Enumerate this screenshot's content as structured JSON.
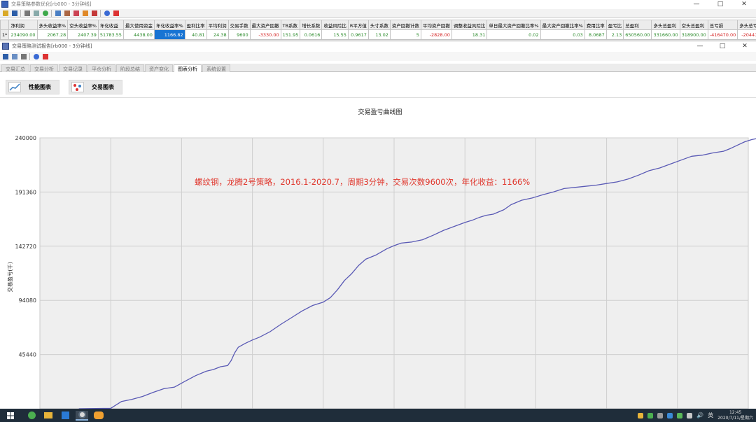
{
  "outer_window": {
    "title": "交易策略参数优化[rb000 - 3分钟线]",
    "controls": {
      "minimize": "—",
      "maximize": "□",
      "close": "✕"
    }
  },
  "metrics_table": {
    "headers": [
      "净利润",
      "多头收益率%",
      "空头收益率%",
      "年化收益",
      "最大使用资金",
      "年化收益率%",
      "盈利比率",
      "平均利润",
      "交易手数",
      "最大资产回撤",
      "TB系数",
      "增长系数",
      "收益风险比",
      "R平方值",
      "头寸系数",
      "资产回撤计数",
      "平均资产回撤",
      "调整收益风险比",
      "单日最大资产回撤比率%",
      "最大资产回撤比率%",
      "费用比率",
      "盈亏比",
      "总盈利",
      "多头总盈利",
      "空头总盈利",
      "总亏损",
      "多头总亏"
    ],
    "row_label": "1*",
    "values": [
      "234090.00",
      "2067.28",
      "2407.39",
      "51783.55",
      "4438.00",
      "1166.82",
      "40.81",
      "24.38",
      "9600",
      "-3330.00",
      "151.95",
      "0.0616",
      "15.55",
      "0.9617",
      "13.02",
      "5",
      "-2828.00",
      "18.31",
      "0.02",
      "0.03",
      "8.0687",
      "2.13",
      "650560.00",
      "331660.00",
      "318900.00",
      "-416470.00",
      "-20441"
    ]
  },
  "inner_window": {
    "title": "交易策略测试报告[rb000 - 3分钟线]",
    "controls": {
      "minimize": "—",
      "maximize": "□",
      "close": "✕"
    }
  },
  "tabs": [
    "交易汇总",
    "交易分析",
    "交易记录",
    "平仓分析",
    "阶段总结",
    "资产变化",
    "图表分析",
    "系统设置"
  ],
  "active_tab": "图表分析",
  "chart_buttons": {
    "performance": "性能图表",
    "trade": "交易图表"
  },
  "chart_data": {
    "type": "line",
    "title": "交易盈亏曲线图",
    "ylabel": "交易盈亏(千)",
    "xlabel": "",
    "yticks": [
      45440,
      94080,
      142720,
      191360,
      240000
    ],
    "ylim": [
      -3200,
      240000
    ],
    "grid": true,
    "annotation": "螺纹钢，龙腾2号策略，2016.1-2020.7，周期3分钟，交易次数9600次，年化收益：1166%",
    "series": [
      {
        "color": "#5a5ab5",
        "points": [
          [
            0.055,
            -3200
          ],
          [
            0.1,
            -2800
          ],
          [
            0.115,
            3200
          ],
          [
            0.13,
            5200
          ],
          [
            0.145,
            7800
          ],
          [
            0.16,
            11500
          ],
          [
            0.175,
            14800
          ],
          [
            0.19,
            16200
          ],
          [
            0.205,
            21500
          ],
          [
            0.22,
            26500
          ],
          [
            0.235,
            30500
          ],
          [
            0.245,
            32000
          ],
          [
            0.255,
            34500
          ],
          [
            0.265,
            35500
          ],
          [
            0.27,
            40000
          ],
          [
            0.275,
            47000
          ],
          [
            0.28,
            52000
          ],
          [
            0.29,
            55500
          ],
          [
            0.3,
            58500
          ],
          [
            0.31,
            61000
          ],
          [
            0.325,
            66000
          ],
          [
            0.34,
            72500
          ],
          [
            0.355,
            78500
          ],
          [
            0.37,
            84500
          ],
          [
            0.385,
            89500
          ],
          [
            0.4,
            92500
          ],
          [
            0.41,
            96500
          ],
          [
            0.42,
            103500
          ],
          [
            0.43,
            112000
          ],
          [
            0.44,
            118000
          ],
          [
            0.45,
            125500
          ],
          [
            0.46,
            131000
          ],
          [
            0.475,
            135000
          ],
          [
            0.49,
            140500
          ],
          [
            0.5,
            143200
          ],
          [
            0.51,
            145500
          ],
          [
            0.525,
            146500
          ],
          [
            0.54,
            148500
          ],
          [
            0.555,
            152500
          ],
          [
            0.57,
            157000
          ],
          [
            0.585,
            160500
          ],
          [
            0.6,
            164000
          ],
          [
            0.61,
            166000
          ],
          [
            0.62,
            168500
          ],
          [
            0.63,
            170500
          ],
          [
            0.64,
            171500
          ],
          [
            0.655,
            175500
          ],
          [
            0.665,
            180000
          ],
          [
            0.68,
            184000
          ],
          [
            0.695,
            186000
          ],
          [
            0.71,
            189000
          ],
          [
            0.725,
            191500
          ],
          [
            0.74,
            194500
          ],
          [
            0.755,
            195500
          ],
          [
            0.77,
            196500
          ],
          [
            0.785,
            197500
          ],
          [
            0.8,
            199000
          ],
          [
            0.815,
            200500
          ],
          [
            0.83,
            203000
          ],
          [
            0.845,
            206500
          ],
          [
            0.86,
            210500
          ],
          [
            0.875,
            213000
          ],
          [
            0.89,
            216500
          ],
          [
            0.905,
            220000
          ],
          [
            0.92,
            223500
          ],
          [
            0.935,
            224500
          ],
          [
            0.95,
            226500
          ],
          [
            0.965,
            228000
          ],
          [
            0.975,
            230500
          ],
          [
            0.985,
            233500
          ],
          [
            0.995,
            236500
          ],
          [
            1.005,
            238500
          ],
          [
            1.02,
            240500
          ],
          [
            1.035,
            241000
          ],
          [
            1.05,
            240000
          ],
          [
            1.065,
            239500
          ]
        ]
      }
    ]
  },
  "taskbar": {
    "clock_time": "12:45",
    "clock_date": "2020/7/11/星期六",
    "ime": "英",
    "volume": "🔊"
  }
}
